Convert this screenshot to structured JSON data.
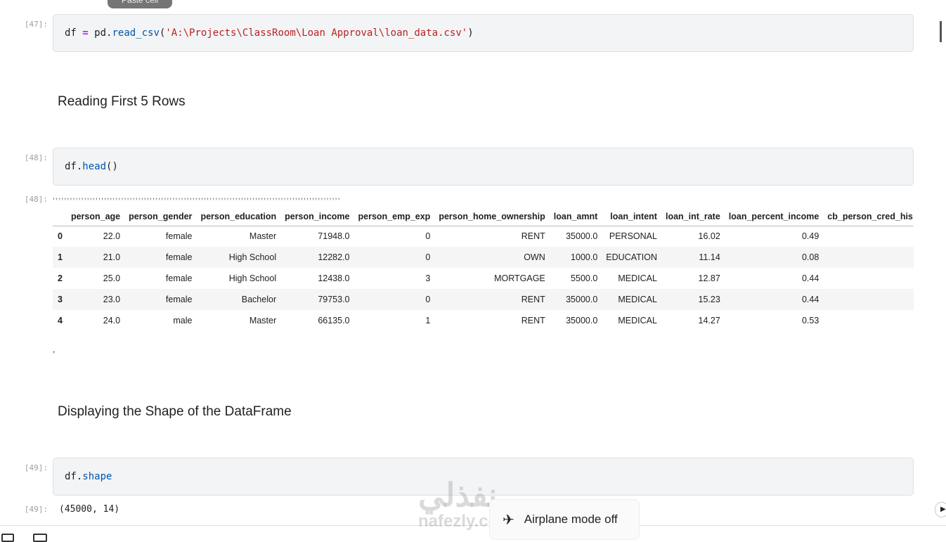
{
  "tooltip": "Paste cell",
  "cells": [
    {
      "prompt": "[47]:",
      "code": {
        "var": "df",
        "op": "=",
        "mod": "pd.",
        "fn": "read_csv",
        "open": "(",
        "str": "'A:\\Projects\\ClassRoom\\Loan Approval\\loan_data.csv'",
        "close": ")"
      }
    },
    {
      "heading": "Reading First 5 Rows"
    },
    {
      "prompt": "[48]:",
      "code": {
        "var": "df.",
        "fn": "head",
        "tail": "()"
      }
    },
    {
      "prompt": "[48]:",
      "dots": ",,,,,,,,,,,,,,,,,,,,,,,,,,,,,,,,,,,,,,,,,,,,,,,,,,,,,,,,,,,,,,,,,,,,,,,,,,,,,,,,,,,,,,,,,,,,,,,,,,,,,",
      "trailing": ","
    },
    {
      "heading": "Displaying the Shape of the DataFrame"
    },
    {
      "prompt": "[49]:",
      "code": {
        "var": "df.",
        "fn": "shape"
      }
    },
    {
      "prompt": "[49]:",
      "output": "(45000, 14)"
    }
  ],
  "table": {
    "columns": [
      "",
      "person_age",
      "person_gender",
      "person_education",
      "person_income",
      "person_emp_exp",
      "person_home_ownership",
      "loan_amnt",
      "loan_intent",
      "loan_int_rate",
      "loan_percent_income",
      "cb_person_cred_his"
    ],
    "rows": [
      [
        "0",
        "22.0",
        "female",
        "Master",
        "71948.0",
        "0",
        "RENT",
        "35000.0",
        "PERSONAL",
        "16.02",
        "0.49",
        ""
      ],
      [
        "1",
        "21.0",
        "female",
        "High School",
        "12282.0",
        "0",
        "OWN",
        "1000.0",
        "EDUCATION",
        "11.14",
        "0.08",
        ""
      ],
      [
        "2",
        "25.0",
        "female",
        "High School",
        "12438.0",
        "3",
        "MORTGAGE",
        "5500.0",
        "MEDICAL",
        "12.87",
        "0.44",
        ""
      ],
      [
        "3",
        "23.0",
        "female",
        "Bachelor",
        "79753.0",
        "0",
        "RENT",
        "35000.0",
        "MEDICAL",
        "15.23",
        "0.44",
        ""
      ],
      [
        "4",
        "24.0",
        "male",
        "Master",
        "66135.0",
        "1",
        "RENT",
        "35000.0",
        "MEDICAL",
        "14.27",
        "0.53",
        ""
      ]
    ]
  },
  "toast": {
    "label": "Airplane mode off",
    "icon": "airplane-icon"
  },
  "watermark": {
    "arabic": "نفذلي",
    "latin": "nafezly.com"
  }
}
